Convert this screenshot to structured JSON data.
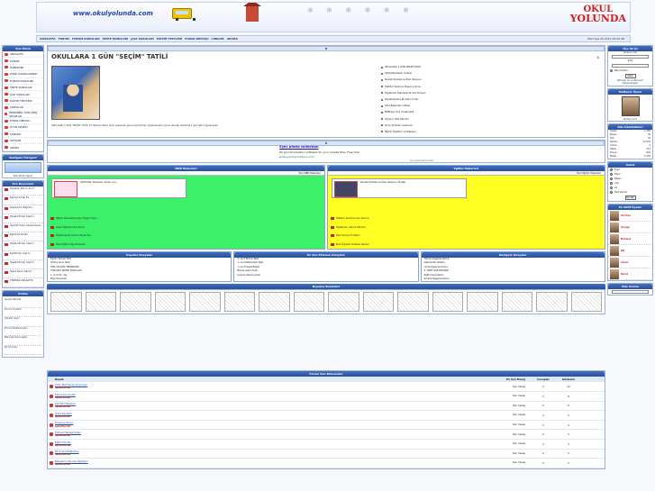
{
  "header": {
    "url": "www.okulyolunda.com",
    "logo_line1": "OKUL",
    "logo_line2": "YOLUNDA"
  },
  "menu": {
    "items": [
      "ANASAYFA",
      "FORUM",
      "FORUM KONULARI",
      "ÜNİTE KONULARI",
      "JALE SORULARI",
      "EĞİTİM TESTLERİ",
      "EVRAK DEPOSU",
      "LİNKLER",
      "ARAMA"
    ],
    "date": "Mart Sas 20.2011 09:06:48"
  },
  "left": {
    "menu_title": "Ana Menü",
    "menu": [
      "ANASAYFA",
      "FORUM",
      "HABERLER",
      "KÖŞE YAZARLARIMIZ",
      "FORUM KONULARI",
      "ÜNİTE KONULARI",
      "JALE SORULARI",
      "EĞİTİM TESTLERİ",
      "VİDEOLAR",
      "PERSONEL TOPLAMIŞ KİTAPLAR",
      "EVRAK DEPOSU",
      "OYUN KÖŞESİ",
      "LİNKLER",
      "İLETİŞİM",
      "ARAMA"
    ],
    "photo_title": "Rastgele Fotoğraf",
    "photo_caption": "Sizin Birim Yapım",
    "announce_title": "Son Duyurular",
    "announcements": [
      "Haseken Birinci Sınıf",
      "Eşit Ayrıntılar Ek",
      "Gaziyanlar Başkanı",
      "Haseki Birleri Yapımı",
      "Özel Birimleri Tamamlama",
      "Eğitimde Birleri",
      "Haseki Birleri Yapımı",
      "Eşit Birleri Yapımı",
      "Haseki Birleri Yapımı",
      "Hepsi Birim Yapımı"
    ],
    "announce_more": "YENİDEN ANASAYFA",
    "stats_title": "Online",
    "stats": [
      "Genel Okurlar",
      "Forum Üyeleri",
      "Sürekli Yayın",
      "Forum Referansları",
      "Barınak Kuruluşları",
      "Ek Ürünler"
    ]
  },
  "feature": {
    "title": "OKULLARA 1 GÜN \"SEÇİM\" TATİLİ",
    "close": "x",
    "body": "OKULLARA 1 GÜN \"SEÇİM\" TATİLİ 12 Haziran Pazar günü yapılacak genel seçimlerde; öğretmenlerin görev alacağı okullarda 1 gün tatil uygulanacak.",
    "related": [
      "OKULLARA 1 GÜN SEÇİM TATİLİ",
      "2009 Maddeleri Ünitesi",
      "Devlet Okullarına Özel Versiyon",
      "Hafızlar Kadrosu Başvuru Sonu",
      "Öğretmen Atamasında Yeni Dönem",
      "Öğretmenlere Ek Ders Ücreti",
      "Okul Başarıları Listesi",
      "MEB'den Yeni Yönetmelik",
      "Öğrenci Tatil Takvimi",
      "Sınav Tarihleri Açıklandı",
      "Eğitim Öğretim Yılı Başladı"
    ]
  },
  "ad": {
    "title": "Sync photo collection",
    "line1": "PC synchronization software for your mobile files. Free trial.",
    "line2": "www.synctoyourphone.com",
    "by": "Google Reklamlar"
  },
  "news": {
    "green_title": "MEB Haberleri",
    "green_more": "Tüm MEB Haberleri",
    "green_lead": "2008 Meb Kadroları Yerleri için...",
    "green_items": [
      "Eğitim Kaynaklarından Özgün Soru...",
      "Aday Öğretmenlik Sınavı",
      "Öğretmenler Kurulu Toplantısı",
      "Özel Eğitim Öğretmenleri"
    ],
    "yellow_title": "Eğitim Haberleri",
    "yellow_more": "Tüm Eğitim Haberleri",
    "yellow_lead": "Devlet Okullarına Özel Versiyon Projesi",
    "yellow_items": [
      "Hafızlar Kadrosu Son Durum",
      "Öğretmen Atama Takvimi",
      "Okul Servis Ücretleri",
      "Meb Öğretim Kalitesi Raporu"
    ]
  },
  "boxes": [
    {
      "title": "Popüler Dosyalar",
      "rows": [
        "Eğitim Karışık Test",
        "Türkçe Konu Testi",
        "HIZLI OKUMA TEKNİKLERİ",
        "TOPLAMA İŞLEMİ SORULARI",
        "1. sınıf Ok. Yaz.",
        "Bilgi Yarışması"
      ]
    },
    {
      "title": "En Son Eklenen Dosyalar",
      "rows": [
        "1. sınıf Türkçe Testi",
        "1. sınıf Matematik Testi",
        "1. sınıf Hayat Bilgisi",
        "Bölme işlemi testi",
        "Çarpım tablosu testi"
      ]
    },
    {
      "title": "Rastgele Dosyalar",
      "rows": [
        "Türkçe Değerlendirme",
        "Matematik Testleri",
        "Ünite Değerlendirme",
        "5. SINIF SÖZ-DEĞİŞİM",
        "Eğitim Kaynakları",
        "Sürekli Değerlendirme"
      ]
    }
  ],
  "gallery_title": "Boyama Resimleri",
  "forum": {
    "title": "Forum Son Eklenenler",
    "headers": [
      "Başlık",
      "En Son Mesaj",
      "Cevaplar",
      "Gösterim"
    ],
    "rows": [
      {
        "t": "2011 Mart Sınav Duyurusu",
        "u": "aykutkocak",
        "last": "Yeni mesaj",
        "c": "0",
        "v": "12"
      },
      {
        "t": "Karne Sonrası Ek",
        "u": "aykutkocak",
        "last": "Yeni mesaj",
        "c": "0",
        "v": "8"
      },
      {
        "t": "Yaz Tatil Ödevleri",
        "u": "aykutkocak",
        "last": "Yeni mesaj",
        "c": "0",
        "v": "6"
      },
      {
        "t": "Ödev Kayıtları",
        "u": "aykutkocak",
        "last": "Yeni mesaj",
        "c": "0",
        "v": "5"
      },
      {
        "t": "Deneme Sınavı",
        "u": "aykutkocak",
        "last": "Yeni mesaj",
        "c": "0",
        "v": "4"
      },
      {
        "t": "Fiziksel Hareket Ödev",
        "u": "aykutkocak",
        "last": "Yeni mesaj",
        "c": "0",
        "v": "4"
      },
      {
        "t": "Eğitim Portalı",
        "u": "aykutkocak",
        "last": "Yeni mesaj",
        "c": "0",
        "v": "3"
      },
      {
        "t": "Ek Dosya Bağlantısı",
        "u": "aykutkocak",
        "last": "Yeni mesaj",
        "c": "0",
        "v": "3"
      },
      {
        "t": "Belgelerin Okuma Öğretimi",
        "u": "aykutkocak",
        "last": "Yeni mesaj",
        "c": "0",
        "v": "2"
      }
    ]
  },
  "right": {
    "login_title": "Üye Girişi",
    "user_label": "Kullanıcı Adı",
    "pass_label": "Şifre",
    "remember": "Beni Hatırla",
    "login_btn": "Giriş",
    "forgot": "Şifrenizi mi unuttunuz?",
    "register": "Hesap Oluştur",
    "best_title": "Haftanın Üyesi",
    "best_name": "ahmet_sonu",
    "stats_title": "Site İstatistikleri",
    "stats": [
      [
        "Üyeler",
        "1.256"
      ],
      [
        "Bugün",
        "35"
      ],
      [
        "Dün",
        "42"
      ],
      [
        "Toplam",
        "12.532"
      ],
      [
        "Online",
        "4"
      ],
      [
        "Haber",
        "312"
      ],
      [
        "Dosya",
        "842"
      ],
      [
        "Mesaj",
        "2.118"
      ]
    ],
    "poll_title": "Anket",
    "poll": [
      "Evet",
      "Hayır",
      "Bazen",
      "Çok",
      "Az",
      "Fark etmez"
    ],
    "poll_btn": "Oy Ver",
    "top_title": "En Aktif Üyeler",
    "top": [
      "Ali Hoca",
      "Zeynep",
      "Mehmet",
      "Elif",
      "Canan",
      "Murat"
    ],
    "search_title": "Site Arama"
  }
}
